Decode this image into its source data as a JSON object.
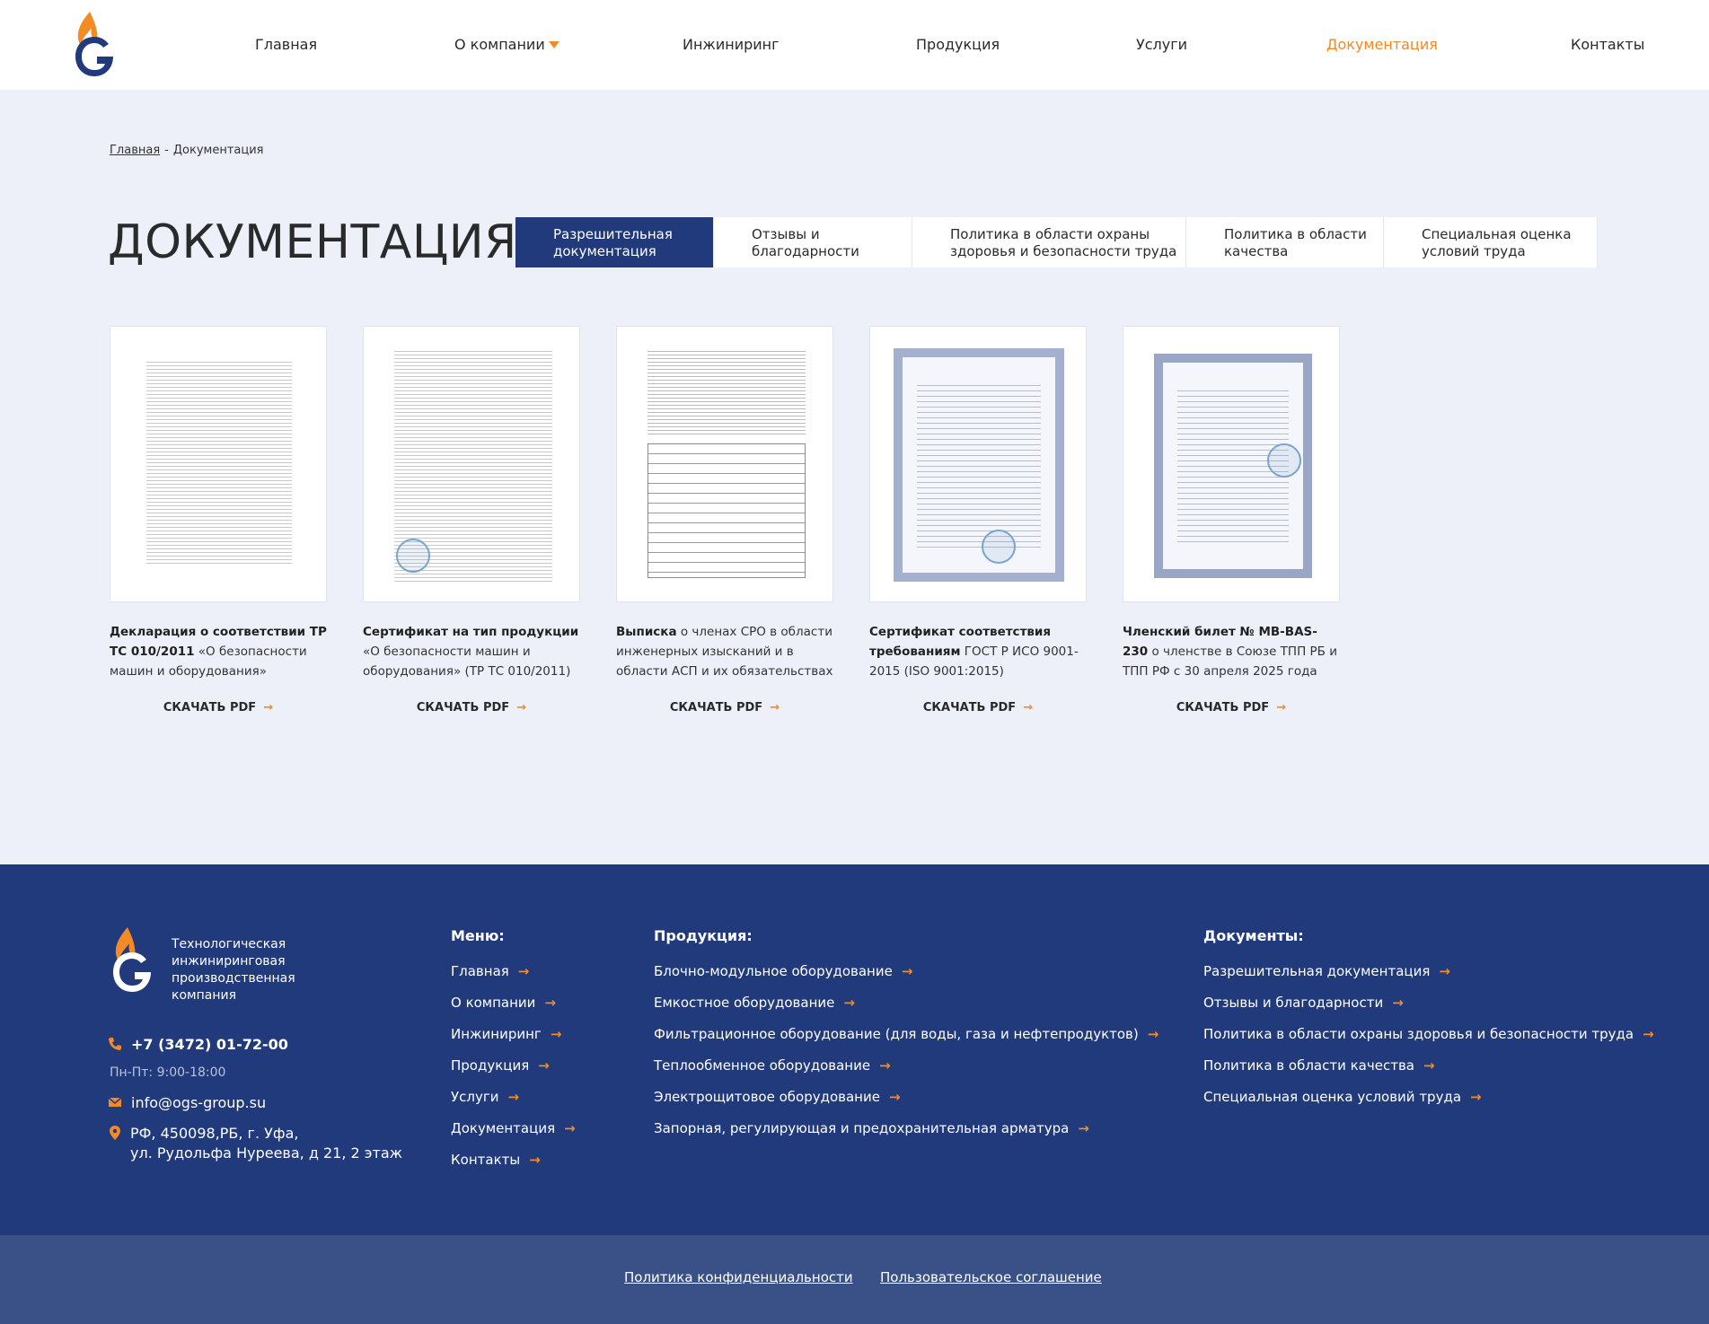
{
  "colors": {
    "accent": "#f28a25",
    "primary": "#213a7c",
    "page_bg": "#edf0f8",
    "subfooter": "#3a5188"
  },
  "header": {
    "logo": "ogs-logo-icon",
    "nav": [
      {
        "label": "Главная"
      },
      {
        "label": "О компании",
        "has_dropdown": true
      },
      {
        "label": "Инжиниринг"
      },
      {
        "label": "Продукция"
      },
      {
        "label": "Услуги"
      },
      {
        "label": "Документация",
        "active": true
      },
      {
        "label": "Контакты"
      }
    ]
  },
  "breadcrumb": {
    "home": "Главная",
    "separator": "-",
    "current": "Документация"
  },
  "page_title": "ДОКУМЕНТАЦИЯ",
  "tabs": [
    {
      "line1": "Разрешительная",
      "line2": "документация",
      "active": true
    },
    {
      "line1": "Отзывы и",
      "line2": "благодарности"
    },
    {
      "line1": "Политика в области охраны",
      "line2": "здоровья и безопасности труда"
    },
    {
      "line1": "Политика в области",
      "line2": "качества"
    },
    {
      "line1": "Специальная оценка",
      "line2": "условий труда"
    }
  ],
  "documents": [
    {
      "bold": "Декларация о соответствии ТР ТС 010/2011",
      "rest": " «О безопасности машин и оборудования»",
      "download": "СКАЧАТЬ PDF"
    },
    {
      "bold": "Сертификат на тип продукции",
      "rest": " «О безопасности машин и оборудования» (ТР ТС 010/2011)",
      "download": "СКАЧАТЬ PDF"
    },
    {
      "bold": "Выписка",
      "rest": " о членах СРО в области инженерных изысканий и в области АСП и их обязательствах",
      "download": "СКАЧАТЬ PDF"
    },
    {
      "bold": "Сертификат соответствия требованиям",
      "rest": " ГОСТ Р ИСО 9001-2015 (ISO 9001:2015)",
      "download": "СКАЧАТЬ PDF"
    },
    {
      "bold": "Членский билет № MB-BAS-230",
      "rest": " о членстве в Союзе ТПП РБ и ТПП РФ с 30 апреля 2025 года",
      "download": "СКАЧАТЬ PDF"
    }
  ],
  "footer": {
    "tagline": "Технологическая инжиниринговая производственная компания",
    "phone": "+7 (3472) 01-72-00",
    "hours": "Пн-Пт: 9:00-18:00",
    "email": "info@ogs-group.su",
    "address_line1": "РФ, 450098,РБ, г. Уфа,",
    "address_line2": "ул. Рудольфа Нуреева, д 21, 2 этаж",
    "menu": {
      "title": "Меню:",
      "items": [
        "Главная",
        "О компании",
        "Инжиниринг",
        "Продукция",
        "Услуги",
        "Документация",
        "Контакты"
      ]
    },
    "products": {
      "title": "Продукция:",
      "items": [
        "Блочно-модульное оборудование",
        "Емкостное оборудование",
        "Фильтрационное оборудование (для воды, газа и нефтепродуктов)",
        "Теплообменное оборудование",
        "Электрощитовое оборудование",
        "Запорная, регулирующая и предохранительная арматура"
      ]
    },
    "documents": {
      "title": "Документы:",
      "items": [
        "Разрешительная документация",
        "Отзывы и благодарности",
        "Политика в области охраны здоровья и безопасности труда",
        "Политика в области качества",
        "Специальная оценка условий труда"
      ]
    }
  },
  "subfooter": {
    "privacy": "Политика конфиденциальности",
    "agreement": "Пользовательское соглашение"
  }
}
